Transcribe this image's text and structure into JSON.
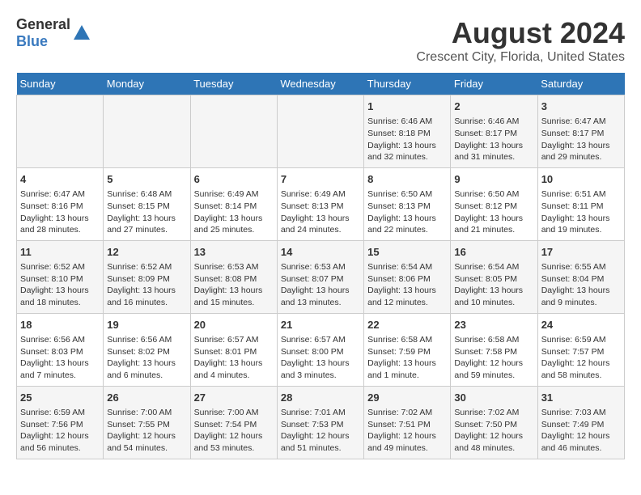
{
  "header": {
    "logo_general": "General",
    "logo_blue": "Blue",
    "title": "August 2024",
    "subtitle": "Crescent City, Florida, United States"
  },
  "weekdays": [
    "Sunday",
    "Monday",
    "Tuesday",
    "Wednesday",
    "Thursday",
    "Friday",
    "Saturday"
  ],
  "weeks": [
    [
      {
        "day": "",
        "info": ""
      },
      {
        "day": "",
        "info": ""
      },
      {
        "day": "",
        "info": ""
      },
      {
        "day": "",
        "info": ""
      },
      {
        "day": "1",
        "info": "Sunrise: 6:46 AM\nSunset: 8:18 PM\nDaylight: 13 hours\nand 32 minutes."
      },
      {
        "day": "2",
        "info": "Sunrise: 6:46 AM\nSunset: 8:17 PM\nDaylight: 13 hours\nand 31 minutes."
      },
      {
        "day": "3",
        "info": "Sunrise: 6:47 AM\nSunset: 8:17 PM\nDaylight: 13 hours\nand 29 minutes."
      }
    ],
    [
      {
        "day": "4",
        "info": "Sunrise: 6:47 AM\nSunset: 8:16 PM\nDaylight: 13 hours\nand 28 minutes."
      },
      {
        "day": "5",
        "info": "Sunrise: 6:48 AM\nSunset: 8:15 PM\nDaylight: 13 hours\nand 27 minutes."
      },
      {
        "day": "6",
        "info": "Sunrise: 6:49 AM\nSunset: 8:14 PM\nDaylight: 13 hours\nand 25 minutes."
      },
      {
        "day": "7",
        "info": "Sunrise: 6:49 AM\nSunset: 8:13 PM\nDaylight: 13 hours\nand 24 minutes."
      },
      {
        "day": "8",
        "info": "Sunrise: 6:50 AM\nSunset: 8:13 PM\nDaylight: 13 hours\nand 22 minutes."
      },
      {
        "day": "9",
        "info": "Sunrise: 6:50 AM\nSunset: 8:12 PM\nDaylight: 13 hours\nand 21 minutes."
      },
      {
        "day": "10",
        "info": "Sunrise: 6:51 AM\nSunset: 8:11 PM\nDaylight: 13 hours\nand 19 minutes."
      }
    ],
    [
      {
        "day": "11",
        "info": "Sunrise: 6:52 AM\nSunset: 8:10 PM\nDaylight: 13 hours\nand 18 minutes."
      },
      {
        "day": "12",
        "info": "Sunrise: 6:52 AM\nSunset: 8:09 PM\nDaylight: 13 hours\nand 16 minutes."
      },
      {
        "day": "13",
        "info": "Sunrise: 6:53 AM\nSunset: 8:08 PM\nDaylight: 13 hours\nand 15 minutes."
      },
      {
        "day": "14",
        "info": "Sunrise: 6:53 AM\nSunset: 8:07 PM\nDaylight: 13 hours\nand 13 minutes."
      },
      {
        "day": "15",
        "info": "Sunrise: 6:54 AM\nSunset: 8:06 PM\nDaylight: 13 hours\nand 12 minutes."
      },
      {
        "day": "16",
        "info": "Sunrise: 6:54 AM\nSunset: 8:05 PM\nDaylight: 13 hours\nand 10 minutes."
      },
      {
        "day": "17",
        "info": "Sunrise: 6:55 AM\nSunset: 8:04 PM\nDaylight: 13 hours\nand 9 minutes."
      }
    ],
    [
      {
        "day": "18",
        "info": "Sunrise: 6:56 AM\nSunset: 8:03 PM\nDaylight: 13 hours\nand 7 minutes."
      },
      {
        "day": "19",
        "info": "Sunrise: 6:56 AM\nSunset: 8:02 PM\nDaylight: 13 hours\nand 6 minutes."
      },
      {
        "day": "20",
        "info": "Sunrise: 6:57 AM\nSunset: 8:01 PM\nDaylight: 13 hours\nand 4 minutes."
      },
      {
        "day": "21",
        "info": "Sunrise: 6:57 AM\nSunset: 8:00 PM\nDaylight: 13 hours\nand 3 minutes."
      },
      {
        "day": "22",
        "info": "Sunrise: 6:58 AM\nSunset: 7:59 PM\nDaylight: 13 hours\nand 1 minute."
      },
      {
        "day": "23",
        "info": "Sunrise: 6:58 AM\nSunset: 7:58 PM\nDaylight: 12 hours\nand 59 minutes."
      },
      {
        "day": "24",
        "info": "Sunrise: 6:59 AM\nSunset: 7:57 PM\nDaylight: 12 hours\nand 58 minutes."
      }
    ],
    [
      {
        "day": "25",
        "info": "Sunrise: 6:59 AM\nSunset: 7:56 PM\nDaylight: 12 hours\nand 56 minutes."
      },
      {
        "day": "26",
        "info": "Sunrise: 7:00 AM\nSunset: 7:55 PM\nDaylight: 12 hours\nand 54 minutes."
      },
      {
        "day": "27",
        "info": "Sunrise: 7:00 AM\nSunset: 7:54 PM\nDaylight: 12 hours\nand 53 minutes."
      },
      {
        "day": "28",
        "info": "Sunrise: 7:01 AM\nSunset: 7:53 PM\nDaylight: 12 hours\nand 51 minutes."
      },
      {
        "day": "29",
        "info": "Sunrise: 7:02 AM\nSunset: 7:51 PM\nDaylight: 12 hours\nand 49 minutes."
      },
      {
        "day": "30",
        "info": "Sunrise: 7:02 AM\nSunset: 7:50 PM\nDaylight: 12 hours\nand 48 minutes."
      },
      {
        "day": "31",
        "info": "Sunrise: 7:03 AM\nSunset: 7:49 PM\nDaylight: 12 hours\nand 46 minutes."
      }
    ]
  ]
}
